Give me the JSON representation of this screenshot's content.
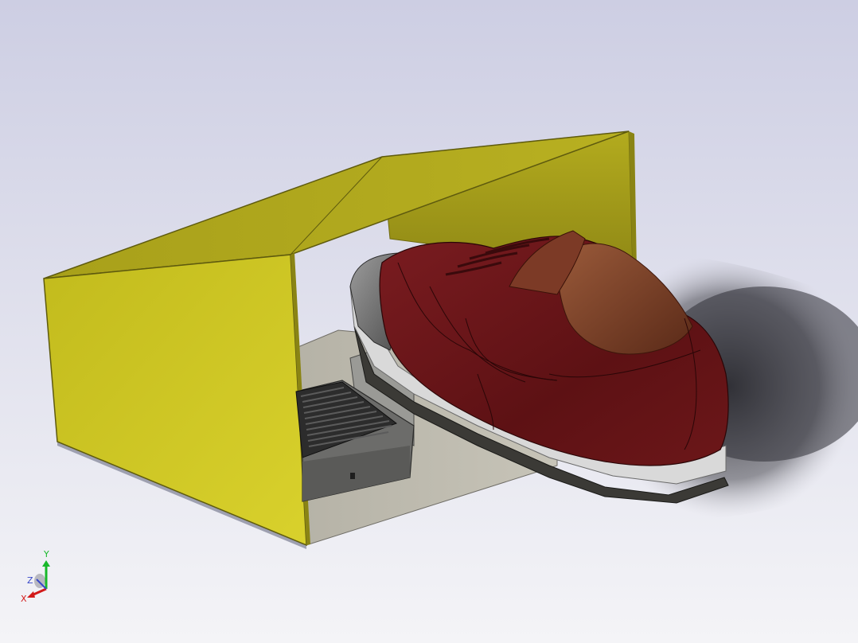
{
  "viewport": {
    "background_top": "#cfd0e4",
    "background_bottom": "#f3f3f7"
  },
  "model": {
    "enclosure_color": "#d3cc28",
    "shoe_upper_color": "#6a1518",
    "shoe_sole_color": "#d8d8d8",
    "pedal_color": "#2e2e2e"
  },
  "triad": {
    "y_label": "Y",
    "z_label": "Z",
    "x_label": "X",
    "y_color": "#18b82a",
    "x_color": "#d21a1a",
    "z_color": "#3848c8"
  }
}
